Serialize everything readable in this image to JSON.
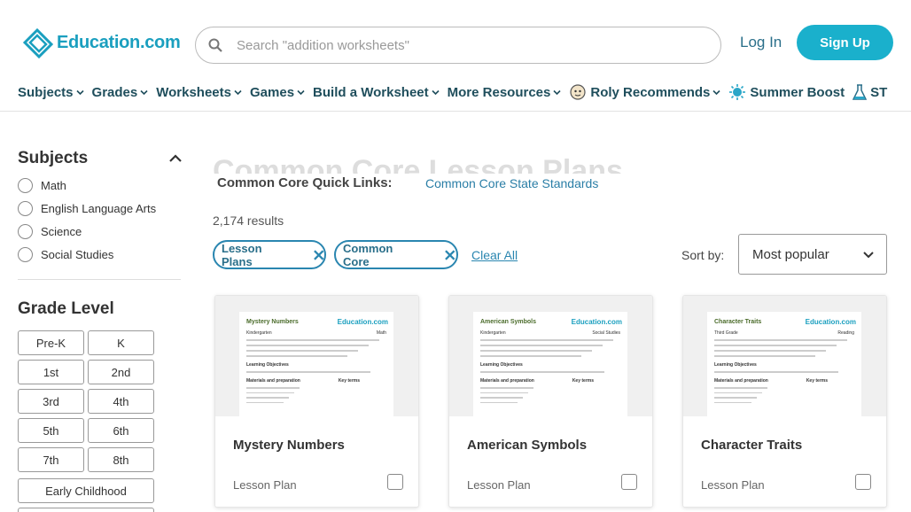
{
  "brand": {
    "name": "Education.com",
    "color": "#1a9fbf"
  },
  "search": {
    "placeholder": "Search \"addition worksheets\"",
    "value": ""
  },
  "auth": {
    "login": "Log In",
    "signup": "Sign Up"
  },
  "nav": [
    {
      "label": "Subjects",
      "icon": ""
    },
    {
      "label": "Grades",
      "icon": ""
    },
    {
      "label": "Worksheets",
      "icon": ""
    },
    {
      "label": "Games",
      "icon": ""
    },
    {
      "label": "Build a Worksheet",
      "icon": ""
    },
    {
      "label": "More Resources",
      "icon": ""
    },
    {
      "label": "Roly Recommends",
      "icon": "roly-icon"
    },
    {
      "label": "Summer Boost",
      "icon": "sun-icon"
    },
    {
      "label": "ST",
      "icon": "flask-icon"
    }
  ],
  "sidebar": {
    "subjects_heading": "Subjects",
    "subjects": [
      "Math",
      "English Language Arts",
      "Science",
      "Social Studies"
    ],
    "grade_heading": "Grade Level",
    "grades": [
      "Pre-K",
      "K",
      "1st",
      "2nd",
      "3rd",
      "4th",
      "5th",
      "6th",
      "7th",
      "8th"
    ],
    "early": "Early Childhood"
  },
  "main": {
    "ghost_title": "Common Core Lesson Plans",
    "quick_label": "Common Core Quick Links:",
    "quick_link": "Common Core State Standards",
    "results": "2,174 results",
    "chips": [
      "Lesson Plans",
      "Common Core"
    ],
    "clear_all": "Clear All",
    "sort_label": "Sort by:",
    "sort_value": "Most popular"
  },
  "cards": [
    {
      "title": "Mystery Numbers",
      "type": "Lesson Plan",
      "doc_title": "Mystery Numbers",
      "doc_grade": "Kindergarten",
      "doc_subject": "Math"
    },
    {
      "title": "American Symbols",
      "type": "Lesson Plan",
      "doc_title": "American Symbols",
      "doc_grade": "Kindergarten",
      "doc_subject": "Social Studies"
    },
    {
      "title": "Character Traits",
      "type": "Lesson Plan",
      "doc_title": "Character Traits",
      "doc_grade": "Third Grade",
      "doc_subject": "Reading"
    }
  ],
  "doc_labels": {
    "objectives": "Learning Objectives",
    "materials": "Materials and preparation",
    "terms": "Key terms",
    "logo": "Education.com"
  }
}
